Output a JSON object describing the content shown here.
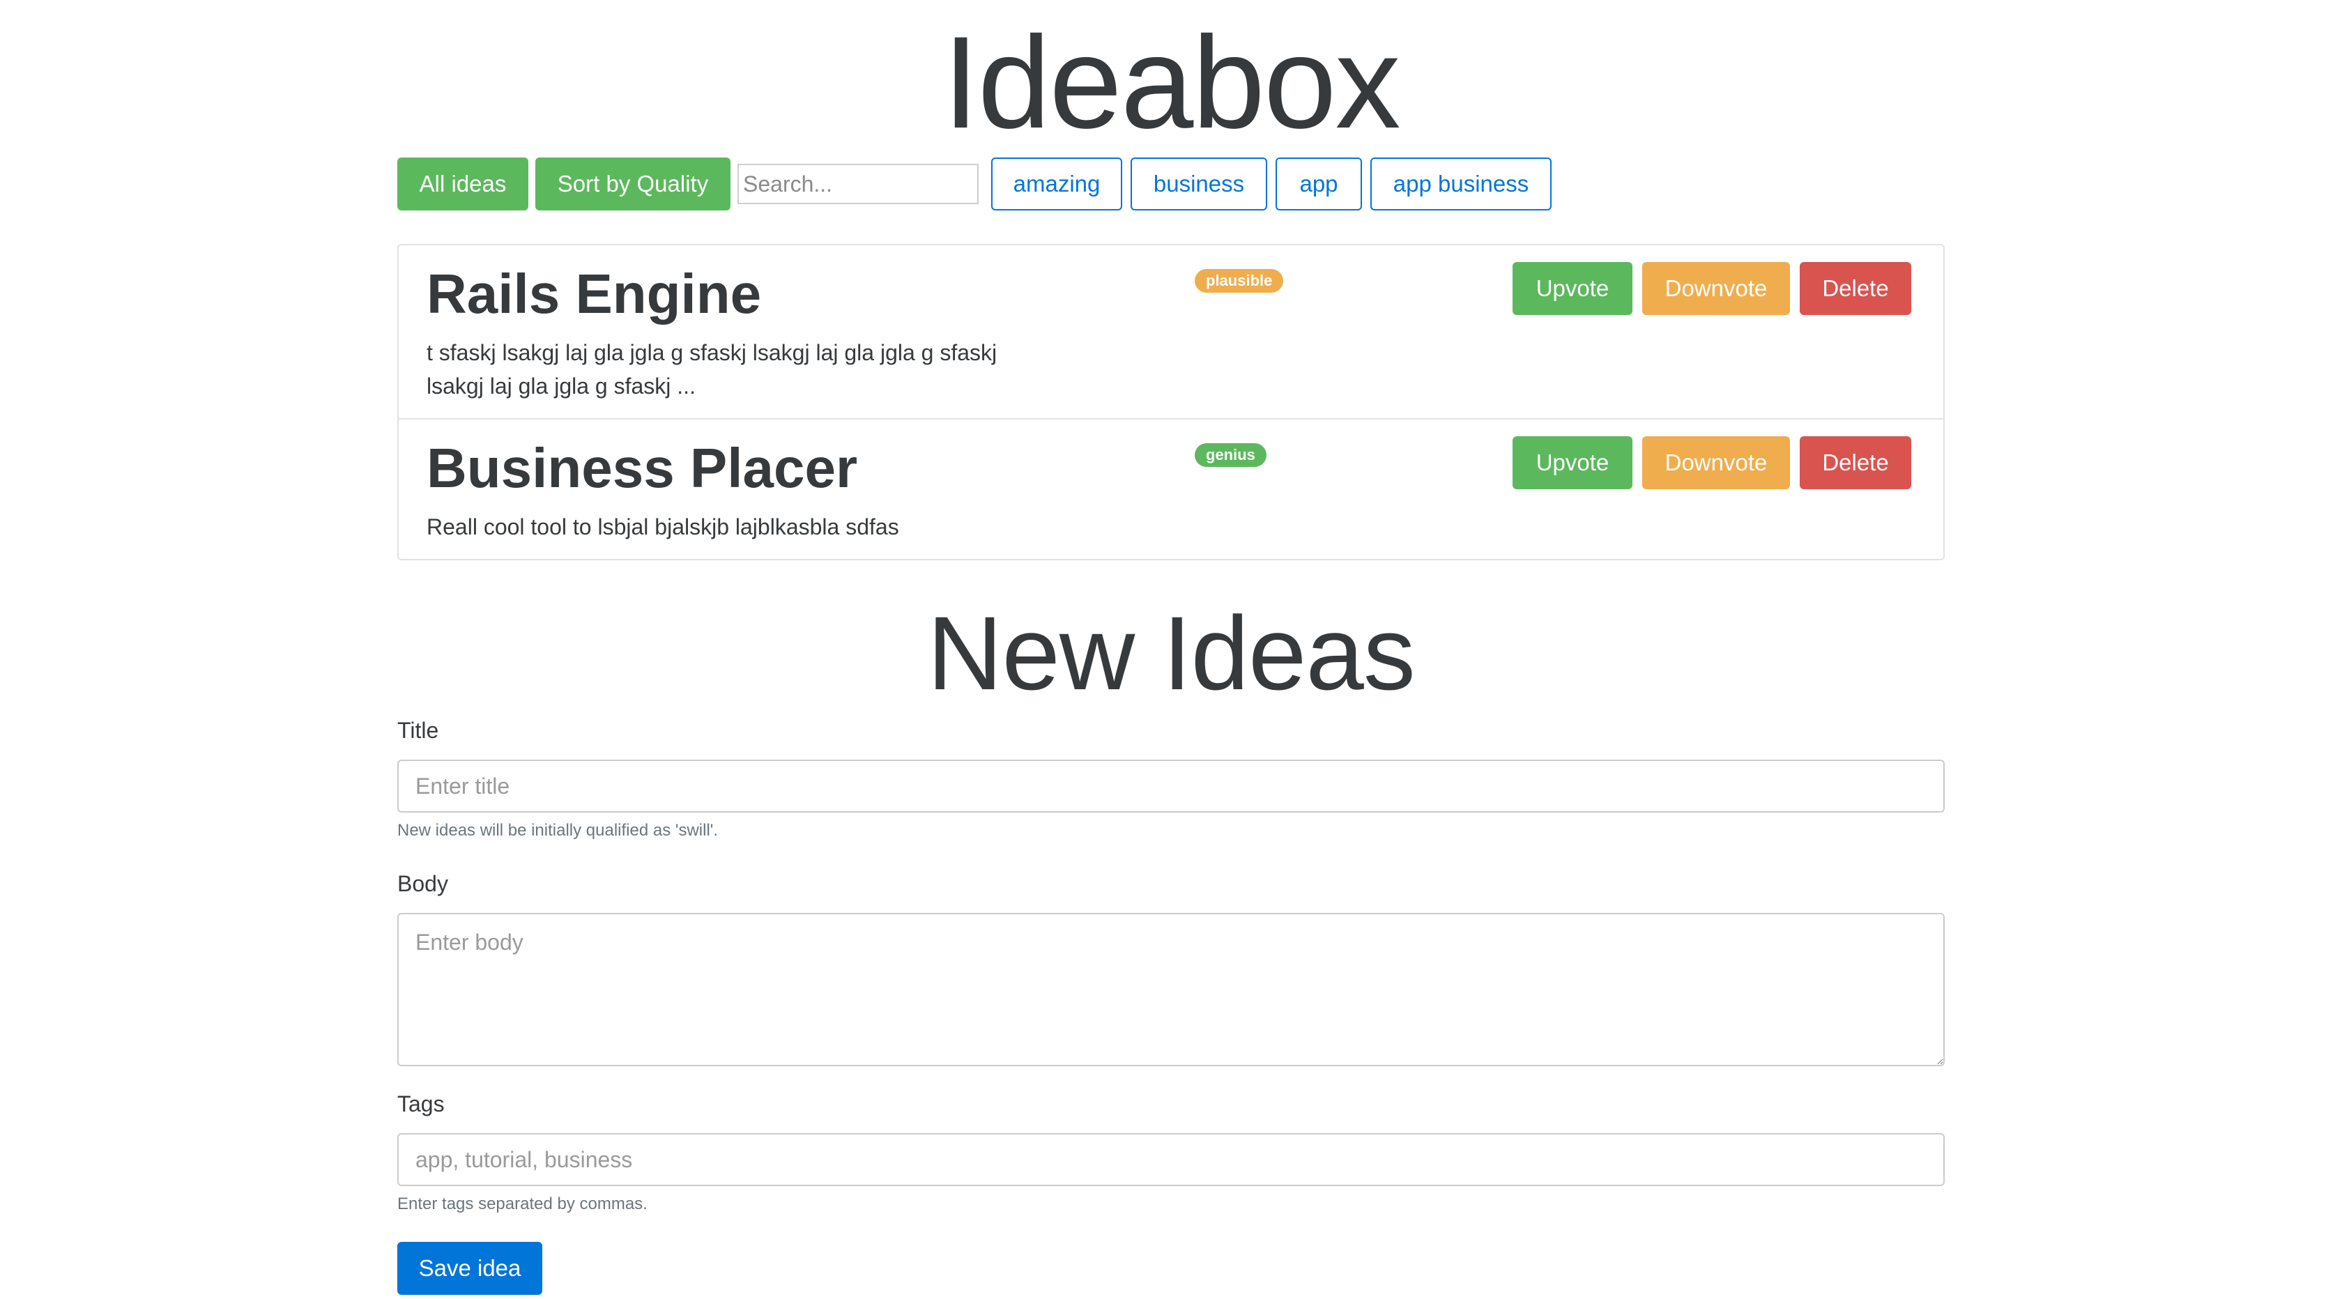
{
  "app": {
    "title": "Ideabox"
  },
  "toolbar": {
    "all_ideas_label": "All ideas",
    "sort_label": "Sort by Quality",
    "search_placeholder": "Search...",
    "tags": [
      "amazing",
      "business",
      "app",
      "app business"
    ]
  },
  "ideas": [
    {
      "title": "Rails Engine",
      "quality": "plausible",
      "body": "t sfaskj lsakgj laj gla jgla g sfaskj lsakgj laj gla jgla g sfaskj lsakgj laj gla jgla g sfaskj ...",
      "upvote_label": "Upvote",
      "downvote_label": "Downvote",
      "delete_label": "Delete"
    },
    {
      "title": "Business Placer",
      "quality": "genius",
      "body": "Reall cool tool to lsbjal bjalskjb lajblkasbla sdfas",
      "upvote_label": "Upvote",
      "downvote_label": "Downvote",
      "delete_label": "Delete"
    }
  ],
  "form": {
    "heading": "New Ideas",
    "title_label": "Title",
    "title_placeholder": "Enter title",
    "title_help": "New ideas will be initially qualified as 'swill'.",
    "body_label": "Body",
    "body_placeholder": "Enter body",
    "tags_label": "Tags",
    "tags_placeholder": "app, tutorial, business",
    "tags_help": "Enter tags separated by commas.",
    "save_label": "Save idea"
  },
  "colors": {
    "success": "#5cb85c",
    "warning": "#f0ad4e",
    "danger": "#d9534f",
    "primary": "#0275d8",
    "text": "#373a3c"
  }
}
